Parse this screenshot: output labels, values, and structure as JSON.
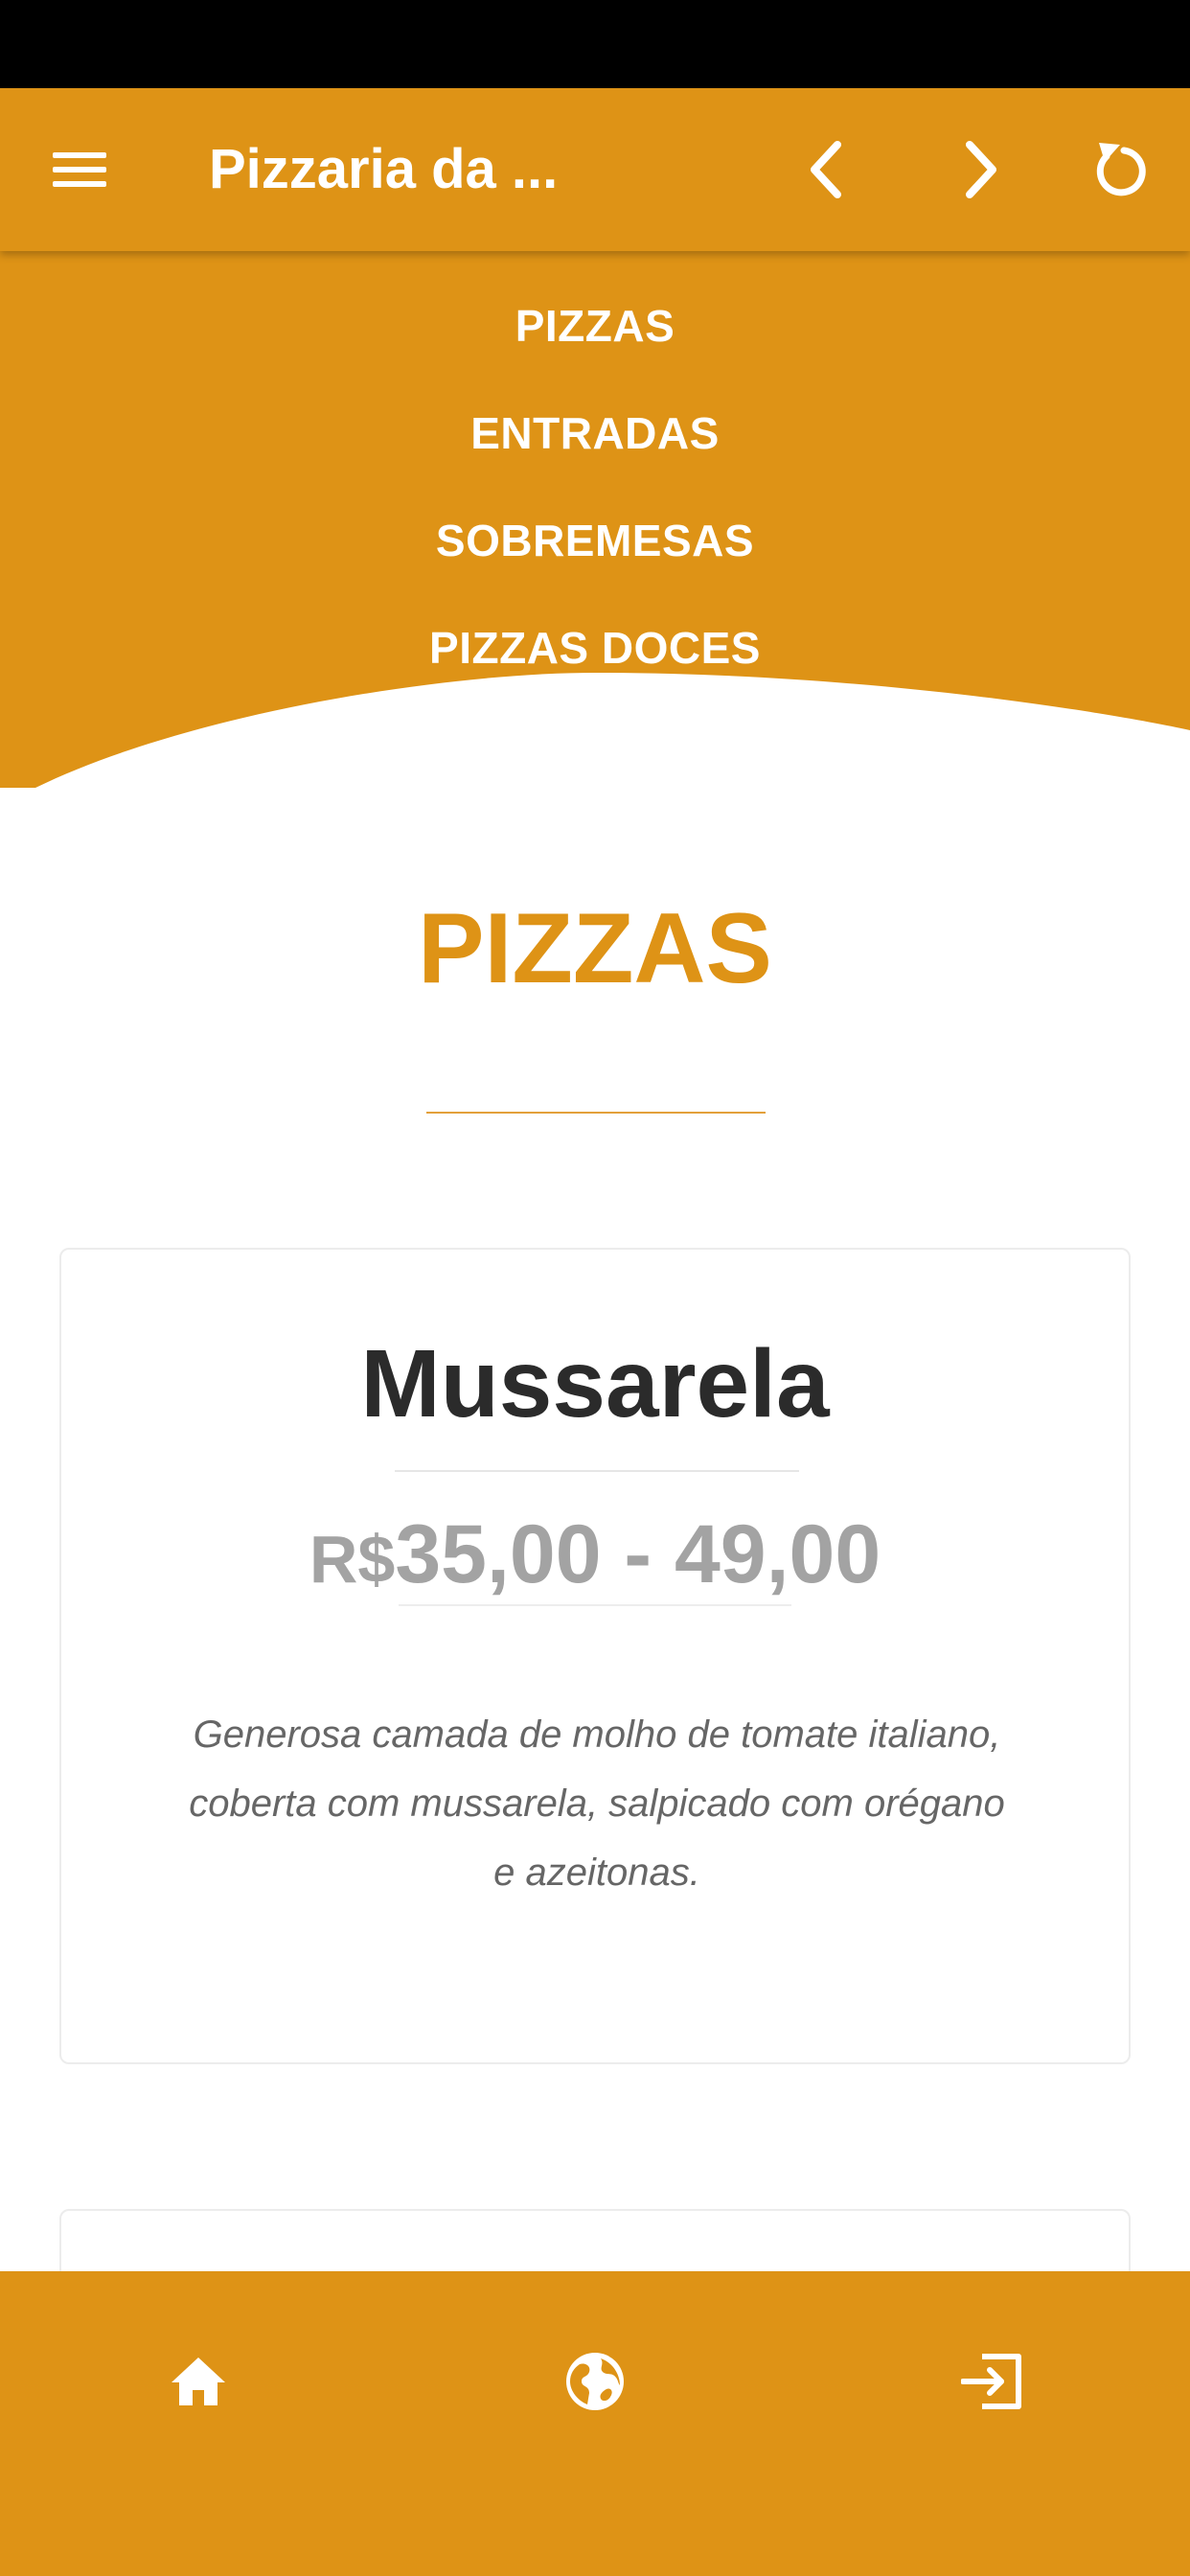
{
  "app_bar": {
    "title": "Pizzaria da ...",
    "icons": [
      "menu-icon",
      "chevron-left-icon",
      "chevron-right-icon",
      "refresh-icon"
    ]
  },
  "hero_nav": {
    "items": [
      "PIZZAS",
      "ENTRADAS",
      "SOBREMESAS",
      "PIZZAS DOCES"
    ]
  },
  "section": {
    "title": "PIZZAS"
  },
  "product": {
    "name": "Mussarela",
    "currency": "R$",
    "price_range": "35,00 - 49,00",
    "description": "Generosa camada de molho de tomate italiano, coberta com mussarela, salpicado com orégano e azeitonas."
  },
  "bottom_nav": {
    "icons": [
      "home-icon",
      "globe-icon",
      "exit-icon"
    ]
  },
  "colors": {
    "brand": "#de9316",
    "title_text": "#2b2b2b",
    "price_text": "#a3a3a3",
    "desc_text": "#666666"
  }
}
